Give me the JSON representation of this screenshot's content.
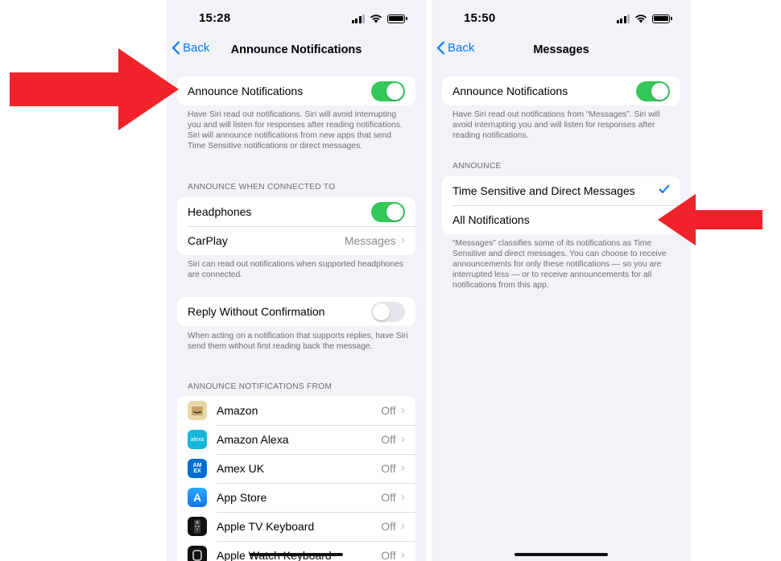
{
  "left": {
    "status": {
      "time": "15:28"
    },
    "nav": {
      "back": "Back",
      "title": "Announce Notifications"
    },
    "announce_row": {
      "label": "Announce Notifications"
    },
    "announce_footer": "Have Siri read out notifications. Siri will avoid interrupting you and will listen for responses after reading notifications. Siri will announce notifications from new apps that send Time Sensitive notifications or direct messages.",
    "connected_header": "Announce when connected to",
    "connected": {
      "headphones": "Headphones",
      "carplay": "CarPlay",
      "carplay_value": "Messages"
    },
    "connected_footer": "Siri can read out notifications when supported headphones are connected.",
    "reply_row": {
      "label": "Reply Without Confirmation"
    },
    "reply_footer": "When acting on a notification that supports replies, have Siri send them without first reading back the message.",
    "apps_header": "Announce notifications from",
    "apps": [
      {
        "name": "Amazon",
        "value": "Off",
        "icon": "amazon-icon",
        "color": "#e9d7a8",
        "glyph": ""
      },
      {
        "name": "Amazon Alexa",
        "value": "Off",
        "icon": "alexa-icon",
        "color": "#17b7d9",
        "glyph": "alexa"
      },
      {
        "name": "Amex UK",
        "value": "Off",
        "icon": "amex-icon",
        "color": "#016fd0",
        "glyph": "AM EX"
      },
      {
        "name": "App Store",
        "value": "Off",
        "icon": "app-store-icon",
        "color": "#1a8cff",
        "glyph": "A"
      },
      {
        "name": "Apple TV Keyboard",
        "value": "Off",
        "icon": "remote-icon",
        "color": "#111111",
        "glyph": ""
      },
      {
        "name": "Apple Watch Keyboard",
        "value": "Off",
        "icon": "watch-icon",
        "color": "#111111",
        "glyph": ""
      }
    ]
  },
  "right": {
    "status": {
      "time": "15:50"
    },
    "nav": {
      "back": "Back",
      "title": "Messages"
    },
    "announce_row": {
      "label": "Announce Notifications"
    },
    "announce_footer": "Have Siri read out notifications from “Messages”. Siri will avoid interrupting you and will listen for responses after reading notifications.",
    "announce_header": "Announce",
    "options": [
      {
        "label": "Time Sensitive and Direct Messages",
        "selected": true
      },
      {
        "label": "All Notifications",
        "selected": false
      }
    ],
    "options_footer": "“Messages” classifies some of its notifications as Time Sensitive and direct messages. You can choose to receive announcements for only these notifications — so you are interrupted less — or to receive announcements for all notifications from this app."
  },
  "colors": {
    "accent": "#007aff",
    "toggle_on": "#34c759",
    "arrow": "#f0232a",
    "background": "#f2f2f7"
  }
}
